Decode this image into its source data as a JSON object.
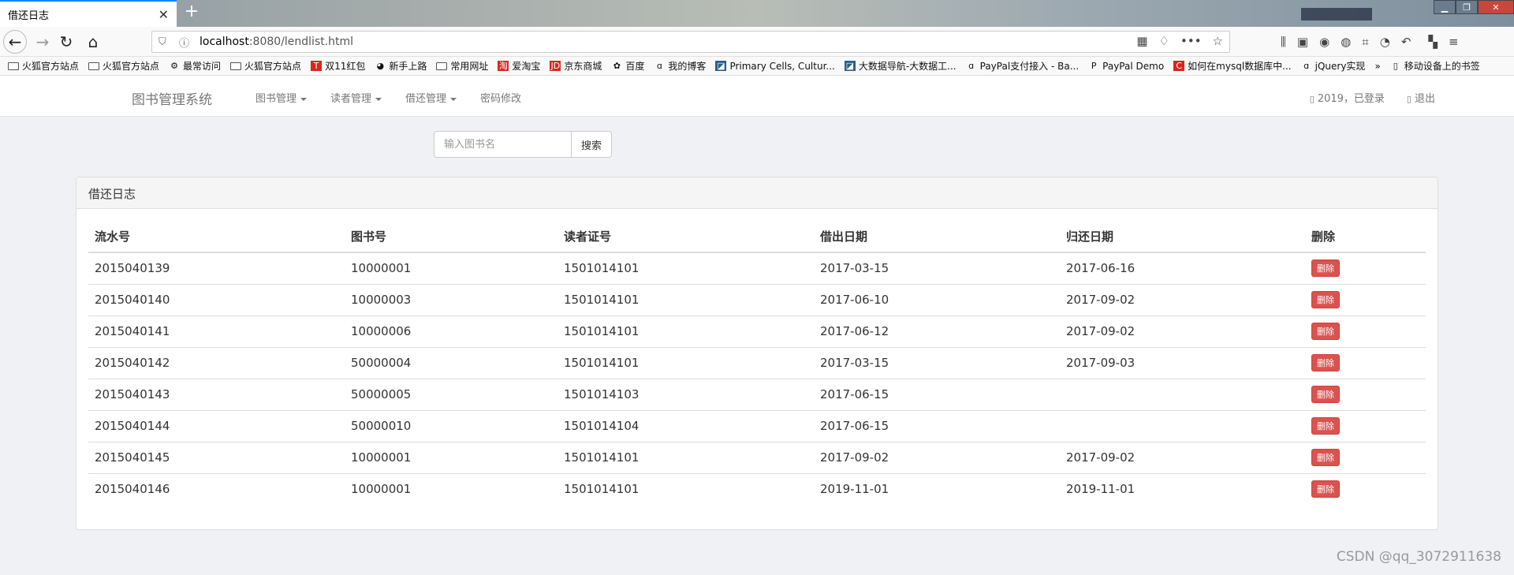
{
  "browser": {
    "tab_title": "借还日志",
    "tab_close": "✕",
    "new_tab": "+",
    "url_host": "localhost",
    "url_rest": ":8080/lendlist.html",
    "bookmarks": [
      {
        "label": "火狐官方站点",
        "icon": "folder-icon"
      },
      {
        "label": "火狐官方站点",
        "icon": "folder-icon"
      },
      {
        "label": "最常访问",
        "icon": "gear-icon"
      },
      {
        "label": "火狐官方站点",
        "icon": "folder-icon"
      },
      {
        "label": "双11红包",
        "icon": "tmall-icon"
      },
      {
        "label": "新手上路",
        "icon": "firefox-icon"
      },
      {
        "label": "常用网址",
        "icon": "folder-icon"
      },
      {
        "label": "爱淘宝",
        "icon": "taobao-icon"
      },
      {
        "label": "京东商城",
        "icon": "jd-icon"
      },
      {
        "label": "百度",
        "icon": "baidu-icon"
      },
      {
        "label": "我的博客",
        "icon": "blog-icon"
      },
      {
        "label": "Primary Cells, Cultur...",
        "icon": "site-icon"
      },
      {
        "label": "大数据导航-大数据工...",
        "icon": "site-icon"
      },
      {
        "label": "PayPal支付接入 - Ba...",
        "icon": "blog-icon"
      },
      {
        "label": "PayPal Demo",
        "icon": "paypal-icon"
      },
      {
        "label": "如何在mysql数据库中...",
        "icon": "csdn-icon"
      },
      {
        "label": "jQuery实现",
        "icon": "blog-icon"
      },
      {
        "label": "»",
        "icon": ""
      },
      {
        "label": "移动设备上的书签",
        "icon": "mobile-icon"
      }
    ]
  },
  "app": {
    "brand": "图书管理系统",
    "menu": [
      {
        "label": "图书管理",
        "dropdown": true
      },
      {
        "label": "读者管理",
        "dropdown": true
      },
      {
        "label": "借还管理",
        "dropdown": true
      },
      {
        "label": "密码修改",
        "dropdown": false
      }
    ],
    "user_status": "2019，已登录",
    "logout": "退出"
  },
  "search": {
    "placeholder": "输入图书名",
    "button": "搜索"
  },
  "panel": {
    "title": "借还日志",
    "columns": [
      "流水号",
      "图书号",
      "读者证号",
      "借出日期",
      "归还日期",
      "删除"
    ],
    "delete_label": "删除",
    "rows": [
      [
        "2015040139",
        "10000001",
        "1501014101",
        "2017-03-15",
        "2017-06-16"
      ],
      [
        "2015040140",
        "10000003",
        "1501014101",
        "2017-06-10",
        "2017-09-02"
      ],
      [
        "2015040141",
        "10000006",
        "1501014101",
        "2017-06-12",
        "2017-09-02"
      ],
      [
        "2015040142",
        "50000004",
        "1501014101",
        "2017-03-15",
        "2017-09-03"
      ],
      [
        "2015040143",
        "50000005",
        "1501014103",
        "2017-06-15",
        ""
      ],
      [
        "2015040144",
        "50000010",
        "1501014104",
        "2017-06-15",
        ""
      ],
      [
        "2015040145",
        "10000001",
        "1501014101",
        "2017-09-02",
        "2017-09-02"
      ],
      [
        "2015040146",
        "10000001",
        "1501014101",
        "2019-11-01",
        "2019-11-01"
      ]
    ]
  },
  "watermark": "CSDN @qq_3072911638",
  "colors": {
    "delete_button": "#d9534f",
    "tab_accent": "#0a84ff"
  }
}
